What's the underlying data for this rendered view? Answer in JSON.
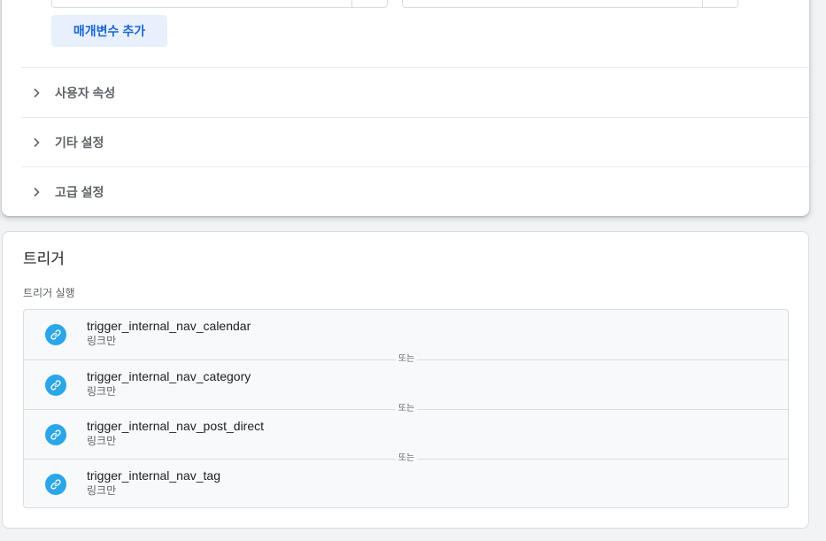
{
  "variables_section": {
    "add_param_label": "매개변수 추가",
    "sections": [
      {
        "label": "사용자 속성"
      },
      {
        "label": "기타 설정"
      },
      {
        "label": "고급 설정"
      }
    ]
  },
  "trigger_section": {
    "title": "트리거",
    "subtitle": "트리거 실행",
    "or_label": "또는",
    "triggers": [
      {
        "name": "trigger_internal_nav_calendar",
        "type": "링크만"
      },
      {
        "name": "trigger_internal_nav_category",
        "type": "링크만"
      },
      {
        "name": "trigger_internal_nav_post_direct",
        "type": "링크만"
      },
      {
        "name": "trigger_internal_nav_tag",
        "type": "링크만"
      }
    ]
  },
  "colors": {
    "accent": "#1967d2",
    "accent_bg": "#e8f0fe",
    "link_icon": "#2aa6e9"
  },
  "icons": {
    "section_chevron": "chevron-right-icon",
    "trigger_type": "link-icon"
  }
}
